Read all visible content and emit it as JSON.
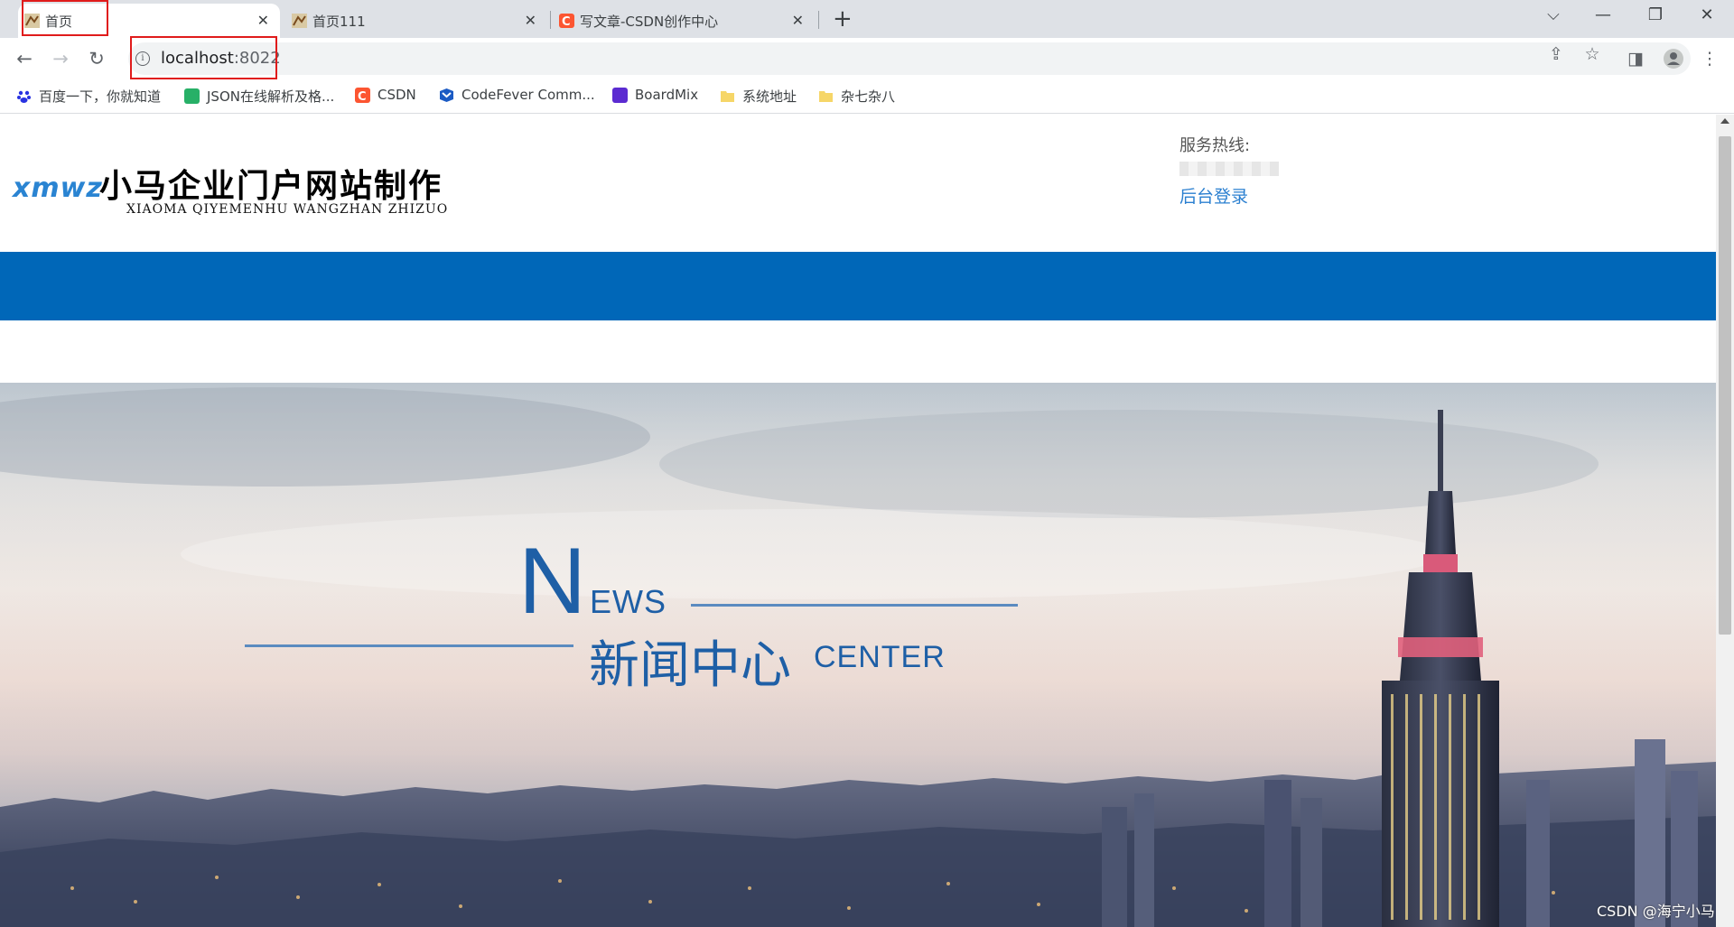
{
  "browser": {
    "tabs": [
      {
        "title": "首页",
        "active": true
      },
      {
        "title": "首页111",
        "active": false
      },
      {
        "title": "写文章-CSDN创作中心",
        "active": false
      }
    ],
    "new_tab_label": "+",
    "window_controls": {
      "list": "⌵",
      "minimize": "—",
      "restore": "❐",
      "close": "✕"
    },
    "nav": {
      "back": "←",
      "forward": "→",
      "reload": "↻"
    },
    "url": {
      "host": "localhost",
      "port": ":8022"
    },
    "toolbar_icons": [
      "share-icon",
      "star-icon",
      "side-panel-icon",
      "profile-icon",
      "menu-icon"
    ],
    "bookmarks": [
      {
        "label": "百度一下，你就知道",
        "icon": "baidu-icon",
        "color": "#2932e1"
      },
      {
        "label": "JSON在线解析及格...",
        "icon": "json-icon",
        "color": "#27b067"
      },
      {
        "label": "CSDN",
        "icon": "csdn-icon",
        "color": "#fc5531"
      },
      {
        "label": "CodeFever Comm...",
        "icon": "codefever-icon",
        "color": "#1b5bc4"
      },
      {
        "label": "BoardMix",
        "icon": "boardmix-icon",
        "color": "#5b2bd1"
      },
      {
        "label": "系统地址",
        "icon": "folder-icon",
        "color": "#f6d668"
      },
      {
        "label": "杂七杂八",
        "icon": "folder-icon",
        "color": "#f6d668"
      }
    ],
    "highlight_color": "#e01b1b"
  },
  "page": {
    "logo": {
      "mark": "xmwz",
      "name": "小马企业门户网站制作",
      "pinyin": "XIAOMA QIYEMENHU WANGZHAN ZHIZUO"
    },
    "service": {
      "label": "服务热线:",
      "admin_link": "后台登录"
    },
    "banner": {
      "n": "N",
      "ews": "EWS",
      "cn_title": "新闻中心",
      "center": "CENTER"
    },
    "colors": {
      "nav_bar": "#0067b8",
      "heading": "#1e5fa6",
      "link": "#2a7fd0"
    }
  },
  "watermark": "CSDN @海宁小马"
}
